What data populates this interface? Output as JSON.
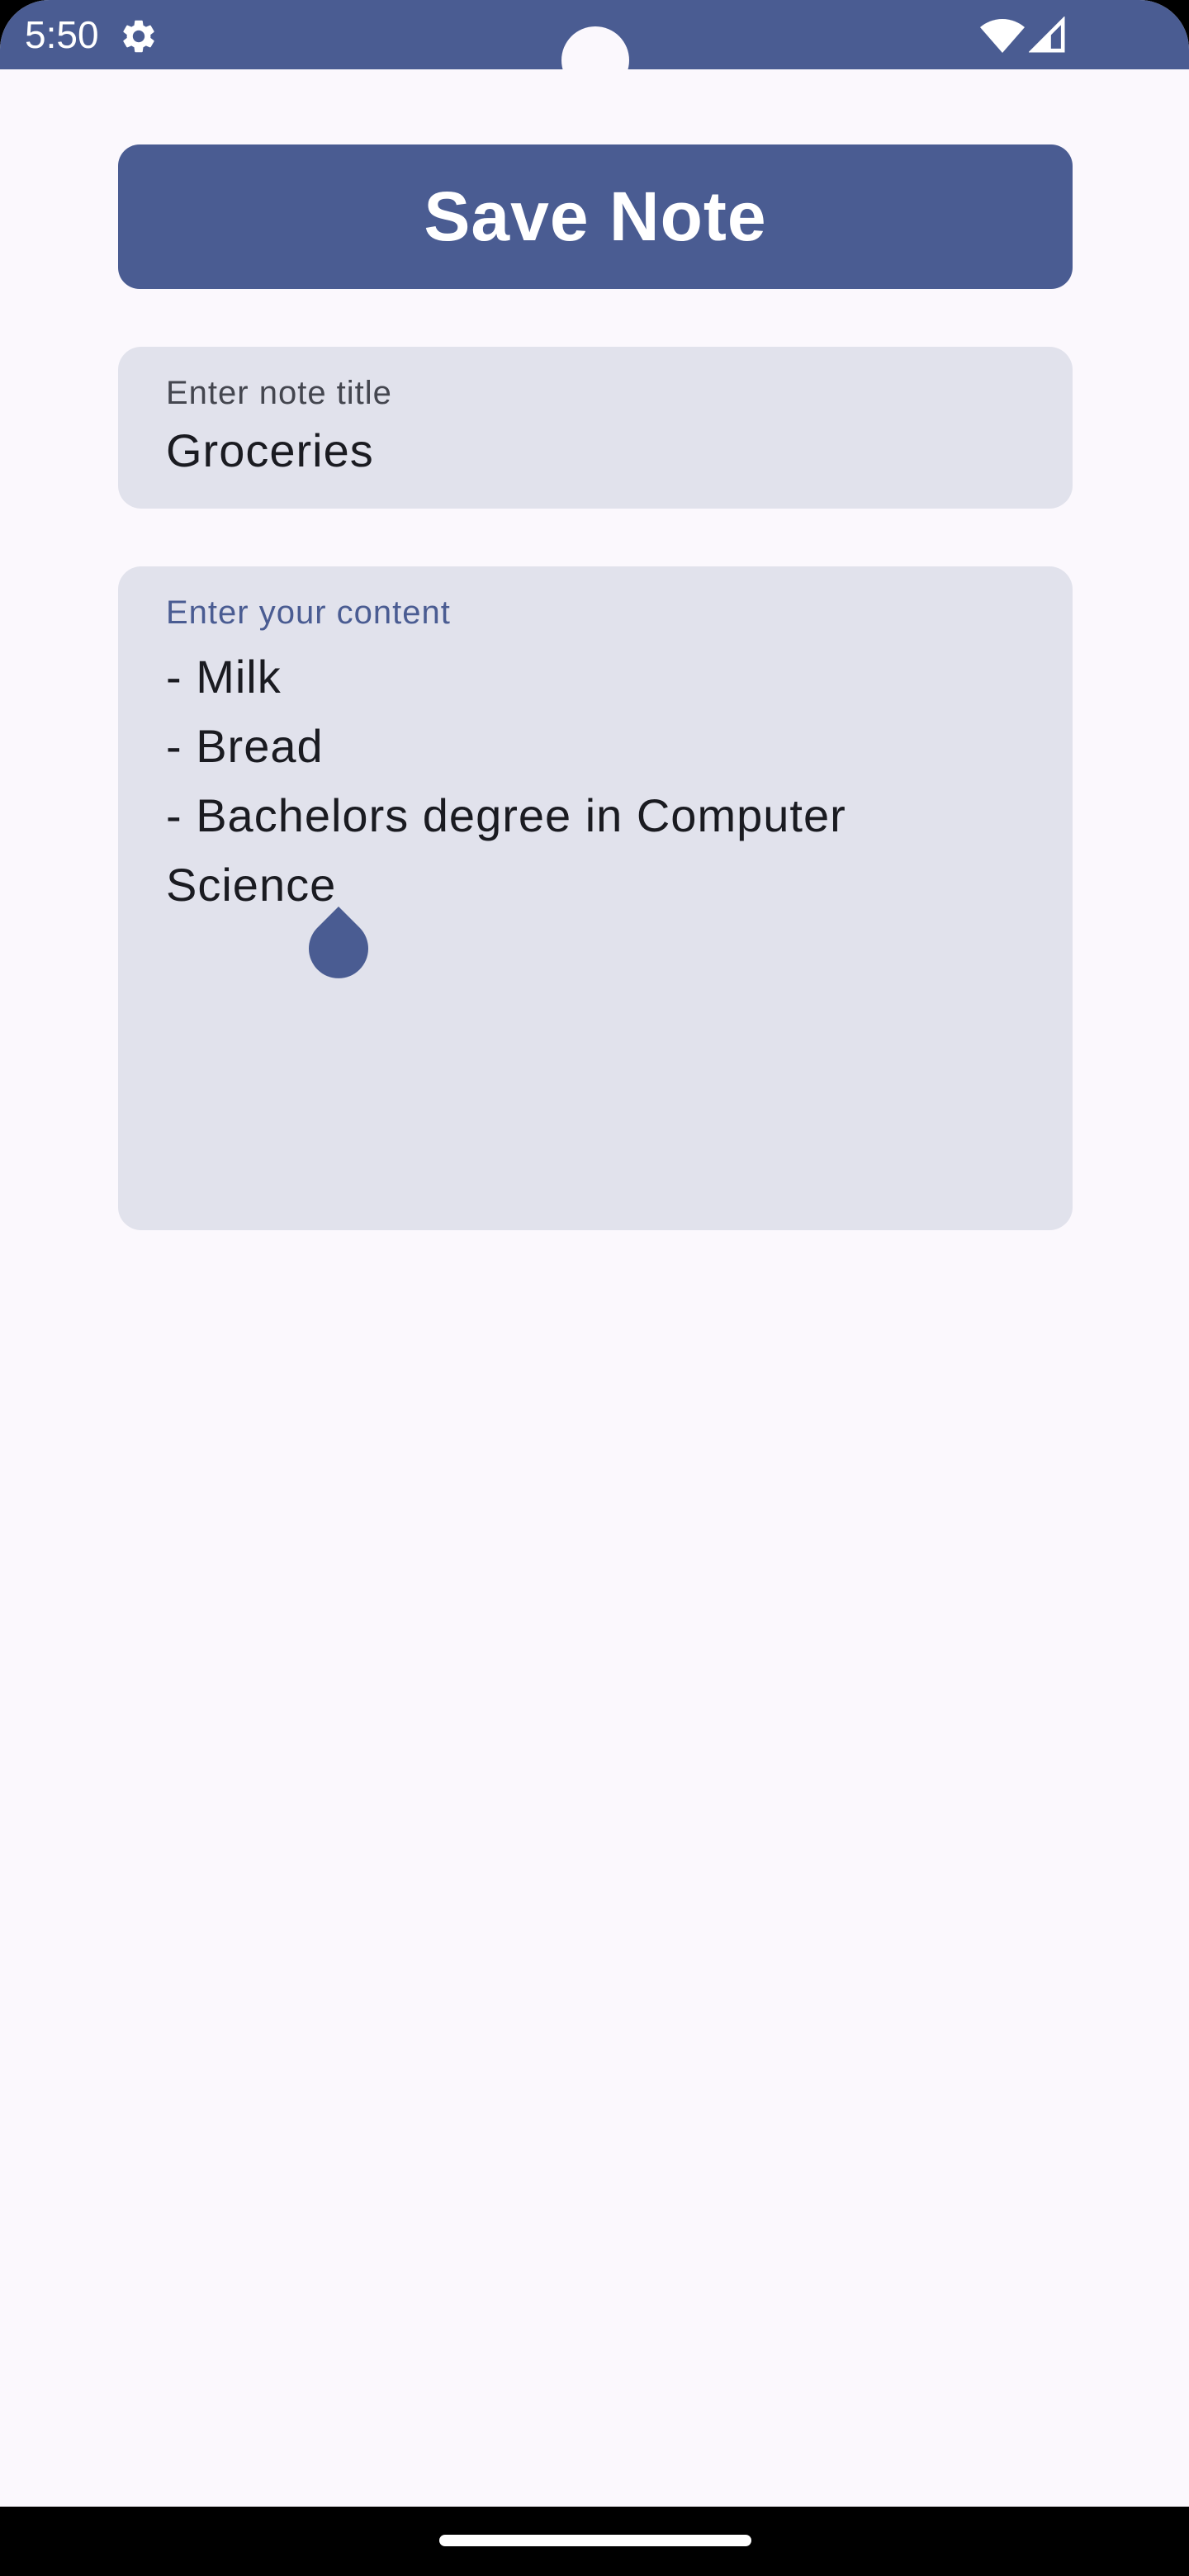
{
  "status_bar": {
    "time": "5:50",
    "icons": [
      "gear-icon",
      "wifi-icon",
      "signal-icon"
    ],
    "background": "#4A5C92"
  },
  "toolbar": {
    "save_label": "Save Note"
  },
  "title_field": {
    "label": "Enter note title",
    "value": "Groceries"
  },
  "content_field": {
    "label": "Enter your content",
    "lines": [
      "- Milk",
      "- Bread",
      "- Bachelors degree in Computer",
      "Science"
    ]
  },
  "colors": {
    "accent": "#4A5C92",
    "field_background": "#E1E2EC",
    "page_background": "#FBF8FD",
    "text": "#1A1B21"
  }
}
